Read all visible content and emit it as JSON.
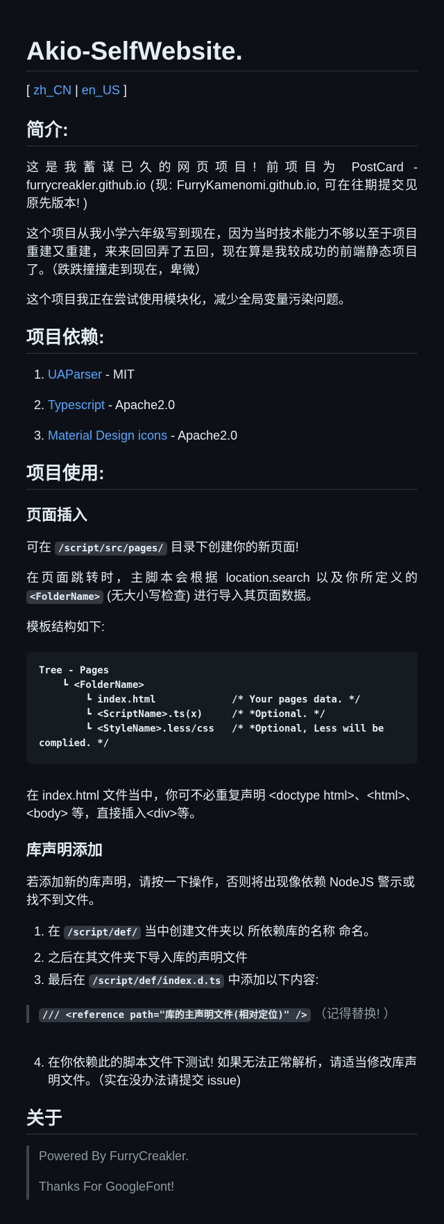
{
  "title": "Akio-SelfWebsite.",
  "lang": {
    "open": "[",
    "zh": "zh_CN",
    "sep": "|",
    "en": "en_US",
    "close": "]"
  },
  "intro": {
    "heading": "简介:",
    "p1": "这是我蓄谋已久的网页项目! 前项目为 PostCard - furrycreakler.github.io (现: FurryKamenomi.github.io, 可在往期提交见原先版本! )",
    "p2": "这个项目从我小学六年级写到现在，因为当时技术能力不够以至于项目重建又重建，来来回回弄了五回，现在算是我较成功的前端静态项目了。（跌跌撞撞走到现在，卑微）",
    "p3": "这个项目我正在尝试使用模块化，减少全局变量污染问题。"
  },
  "deps": {
    "heading": "项目依赖:",
    "items": [
      {
        "name": "UAParser",
        "license": " - MIT"
      },
      {
        "name": "Typescript",
        "license": " - Apache2.0"
      },
      {
        "name": "Material Design icons",
        "license": " - Apache2.0"
      }
    ]
  },
  "usage": {
    "heading": "项目使用:",
    "insert_heading": "页面插入",
    "p1_pre": "可在 ",
    "p1_code": "/script/src/pages/",
    "p1_post": " 目录下创建你的新页面!",
    "p2_pre": "在页面跳转时，主脚本会根据 location.search 以及你所定义的 ",
    "p2_code": "<FolderName>",
    "p2_post": " (无大小写检查) 进行导入其页面数据。",
    "p3": "模板结构如下:",
    "code_block": "Tree - Pages\n    ┗ <FolderName>\n        ┗ index.html             /* Your pages data. */\n        ┗ <ScriptName>.ts(x)     /* *Optional. */\n        ┗ <StyleName>.less/css   /* *Optional, Less will be complied. */",
    "p4": "在 index.html 文件当中，你可不必重复声明 <doctype html>、<html>、<body> 等，直接插入<div>等。"
  },
  "lib": {
    "heading": "库声明添加",
    "p1": "若添加新的库声明，请按一下操作，否则将出现像依赖 NodeJS 警示或找不到文件。",
    "s1_pre": "在 ",
    "s1_code": "/script/def/",
    "s1_post": " 当中创建文件夹以 所依赖库的名称 命名。",
    "s2": "之后在其文件夹下导入库的声明文件",
    "s3_pre": "最后在 ",
    "s3_code": "/script/def/index.d.ts",
    "s3_post": " 中添加以下内容:",
    "quote_code": "/// <reference path=\"库的主声明文件(相对定位)\" />",
    "quote_post": " （记得替换! ）",
    "s4": "在你依赖此的脚本文件下测试! 如果无法正常解析，请适当修改库声明文件。（实在没办法请提交 issue)"
  },
  "about": {
    "heading": "关于",
    "line1": "Powered By FurryCreakler.",
    "line2": "Thanks For GoogleFont!"
  }
}
